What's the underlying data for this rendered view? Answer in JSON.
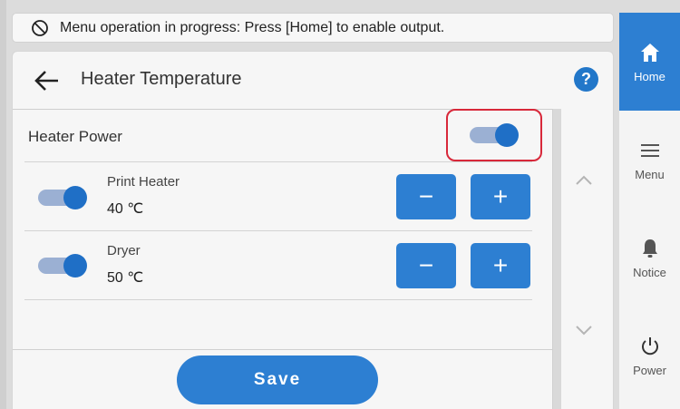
{
  "status_bar": {
    "icon": "no-output-icon",
    "message": "Menu operation in progress: Press [Home] to enable output."
  },
  "header": {
    "back_icon": "arrow-left-icon",
    "title": "Heater Temperature",
    "help_label": "?"
  },
  "heater_power": {
    "label": "Heater Power",
    "enabled": true
  },
  "heaters": [
    {
      "name": "Print Heater",
      "value": "40 ℃",
      "enabled": true,
      "minus": "−",
      "plus": "+"
    },
    {
      "name": "Dryer",
      "value": "50 ℃",
      "enabled": true,
      "minus": "−",
      "plus": "+"
    }
  ],
  "save_label": "Save",
  "side_nav": [
    {
      "label": "Home",
      "icon": "home-icon",
      "active": true
    },
    {
      "label": "Menu",
      "icon": "hamburger-menu-icon",
      "active": false
    },
    {
      "label": "Notice",
      "icon": "bell-icon",
      "active": false
    },
    {
      "label": "Power",
      "icon": "power-icon",
      "active": false
    }
  ],
  "colors": {
    "accent": "#2d7fd2",
    "highlight": "#d8283a",
    "toggle_track": "#9bb0d3"
  }
}
